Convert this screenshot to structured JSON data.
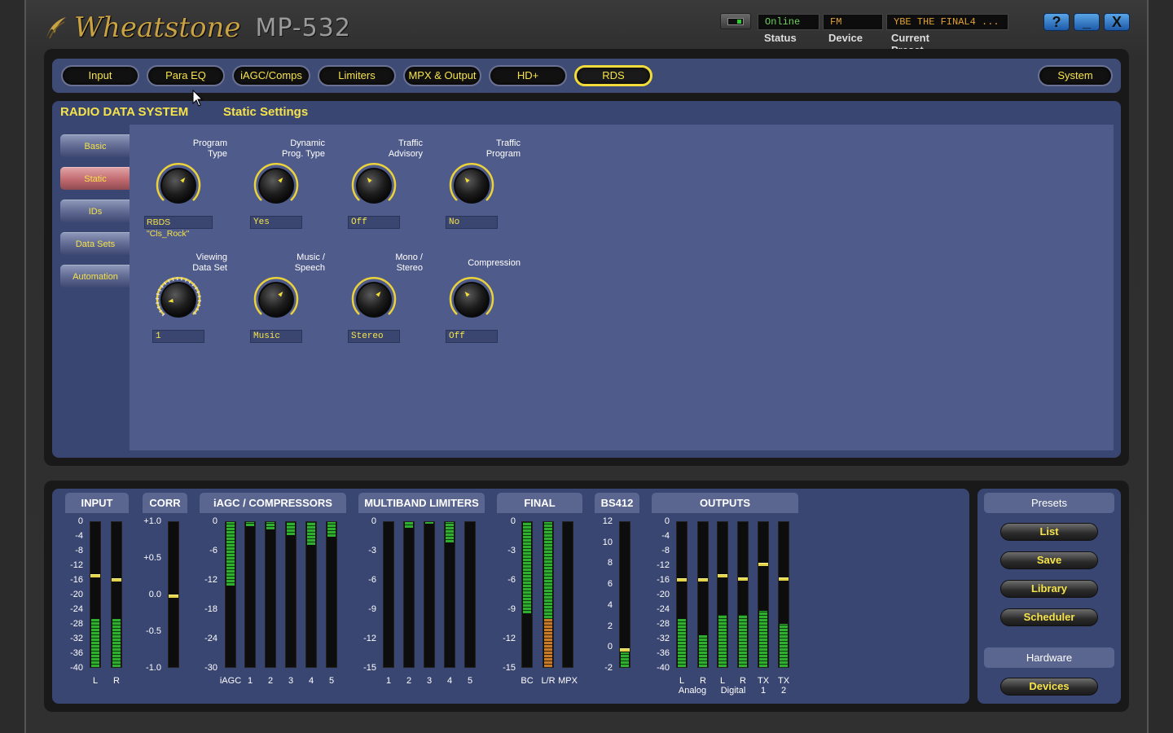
{
  "app": {
    "brand": "Wheatstone",
    "model": "MP-532"
  },
  "status": {
    "status_value": "Online",
    "status_label": "Status",
    "device_value": "FM",
    "device_label": "Device",
    "preset_value": "YBE THE FINAL4  ...",
    "preset_label": "Current Preset"
  },
  "window_buttons": {
    "help": "?",
    "minimize": "_",
    "close": "X"
  },
  "tabs": [
    "Input",
    "Para EQ",
    "iAGC/Comps",
    "Limiters",
    "MPX & Output",
    "HD+",
    "RDS"
  ],
  "system_tab": "System",
  "active_tab": "RDS",
  "section_title": "RADIO DATA SYSTEM",
  "sub_title": "Static Settings",
  "side_menu": [
    "Basic",
    "Static",
    "IDs",
    "Data Sets",
    "Automation"
  ],
  "active_side": "Static",
  "controls": [
    {
      "label1": "Program",
      "label2": "Type",
      "value": "RBDS \"Cls_Rock\"",
      "angle": 40
    },
    {
      "label1": "Dynamic",
      "label2": "Prog. Type",
      "value": "Yes",
      "angle": 40
    },
    {
      "label1": "Traffic",
      "label2": "Advisory",
      "value": "Off",
      "angle": -40
    },
    {
      "label1": "Traffic",
      "label2": "Program",
      "value": "No",
      "angle": -40
    },
    {
      "label1": "Viewing",
      "label2": "Data Set",
      "value": "1",
      "angle": -100
    },
    {
      "label1": "Music /",
      "label2": "Speech",
      "value": "Music",
      "angle": 40
    },
    {
      "label1": "Mono /",
      "label2": "Stereo",
      "value": "Stereo",
      "angle": 40
    },
    {
      "label1": "",
      "label2": "Compression",
      "value": "Off",
      "angle": -40
    }
  ],
  "meter_sections": {
    "input": "INPUT",
    "corr": "CORR",
    "iagc": "iAGC / COMPRESSORS",
    "limiters": "MULTIBAND LIMITERS",
    "final": "FINAL",
    "bs412": "BS412",
    "outputs": "OUTPUTS"
  },
  "scales": {
    "input": [
      "0",
      "-4",
      "-8",
      "-12",
      "-16",
      "-20",
      "-24",
      "-28",
      "-32",
      "-36",
      "-40"
    ],
    "corr": [
      "+1.0",
      "+0.5",
      "0.0",
      "-0.5",
      "-1.0"
    ],
    "iagc": [
      "0",
      "-6",
      "-12",
      "-18",
      "-24",
      "-30"
    ],
    "limiters": [
      "0",
      "-3",
      "-6",
      "-9",
      "-12",
      "-15"
    ],
    "final": [
      "0",
      "-3",
      "-6",
      "-9",
      "-12",
      "-15"
    ],
    "bs412": [
      "12",
      "10",
      "8",
      "6",
      "4",
      "2",
      "0",
      "-2"
    ],
    "outputs": [
      "0",
      "-4",
      "-8",
      "-12",
      "-16",
      "-20",
      "-24",
      "-28",
      "-32",
      "-36",
      "-40"
    ]
  },
  "channel_labels": {
    "input": [
      "L",
      "R"
    ],
    "iagc": [
      "iAGC",
      "1",
      "2",
      "3",
      "4",
      "5"
    ],
    "limiters": [
      "1",
      "2",
      "3",
      "4",
      "5"
    ],
    "final": [
      "BC",
      "L/R",
      "MPX"
    ],
    "outputs": [
      "L",
      "R",
      "L",
      "R",
      "TX",
      "TX"
    ],
    "outputs_sub": [
      "Analog",
      "Digital",
      "1",
      "2"
    ]
  },
  "meter_levels": {
    "input": [
      {
        "fill": 0.33,
        "peak": 0.64
      },
      {
        "fill": 0.33,
        "peak": 0.61
      }
    ],
    "corr": [
      {
        "fill": 0,
        "peak": 0.5
      }
    ],
    "iagc": [
      0.44,
      0.03,
      0.05,
      0.09,
      0.16,
      0.1
    ],
    "limiters": [
      0,
      0.04,
      0.01,
      0.14,
      0
    ],
    "final": [
      {
        "fill": 0.63,
        "top": true
      },
      {
        "fill": 1.0,
        "orange": 0.33
      },
      {
        "fill": 0
      }
    ],
    "bs412": [
      {
        "fill": 0.1,
        "peak": 0.13
      }
    ],
    "outputs": [
      {
        "fill": 0.33,
        "peak": 0.61
      },
      {
        "fill": 0.22,
        "peak": 0.61
      },
      {
        "fill": 0.36,
        "peak": 0.64
      },
      {
        "fill": 0.36,
        "peak": 0.62
      },
      {
        "fill": 0.39,
        "peak": 0.72
      },
      {
        "fill": 0.3,
        "peak": 0.62
      }
    ]
  },
  "presets": {
    "title": "Presets",
    "buttons": [
      "List",
      "Save",
      "Library",
      "Scheduler"
    ]
  },
  "hardware": {
    "title": "Hardware",
    "button": "Devices"
  }
}
